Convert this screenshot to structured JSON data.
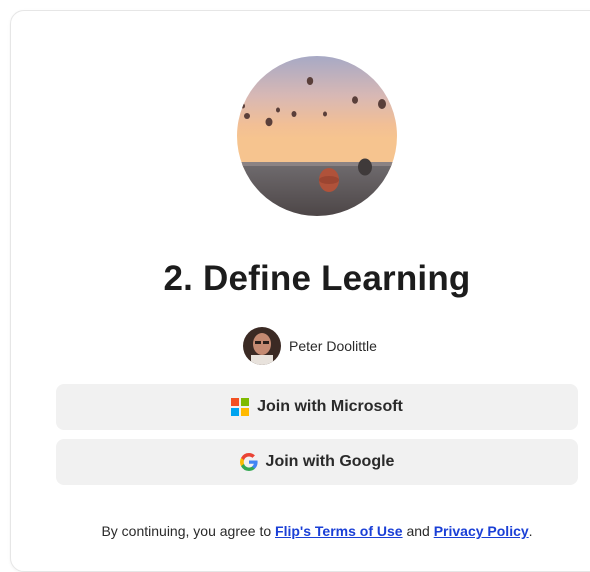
{
  "title": "2. Define Learning",
  "author": {
    "name": "Peter Doolittle"
  },
  "buttons": {
    "microsoft_label": "Join with Microsoft",
    "google_label": "Join with Google"
  },
  "legal": {
    "prefix": "By continuing, you agree to",
    "terms_link": "Flip's Terms of Use",
    "middle": "and",
    "privacy_link": "Privacy Policy",
    "suffix": "."
  },
  "icons": {
    "cover": "hot-air-balloons-photo",
    "avatar": "user-avatar-photo",
    "microsoft": "microsoft-logo-icon",
    "google": "google-logo-icon"
  },
  "colors": {
    "link": "#1a3fd6",
    "button_bg": "#f1f1f1",
    "ms_red": "#f25022",
    "ms_green": "#7fba00",
    "ms_blue": "#00a4ef",
    "ms_yellow": "#ffb900"
  }
}
